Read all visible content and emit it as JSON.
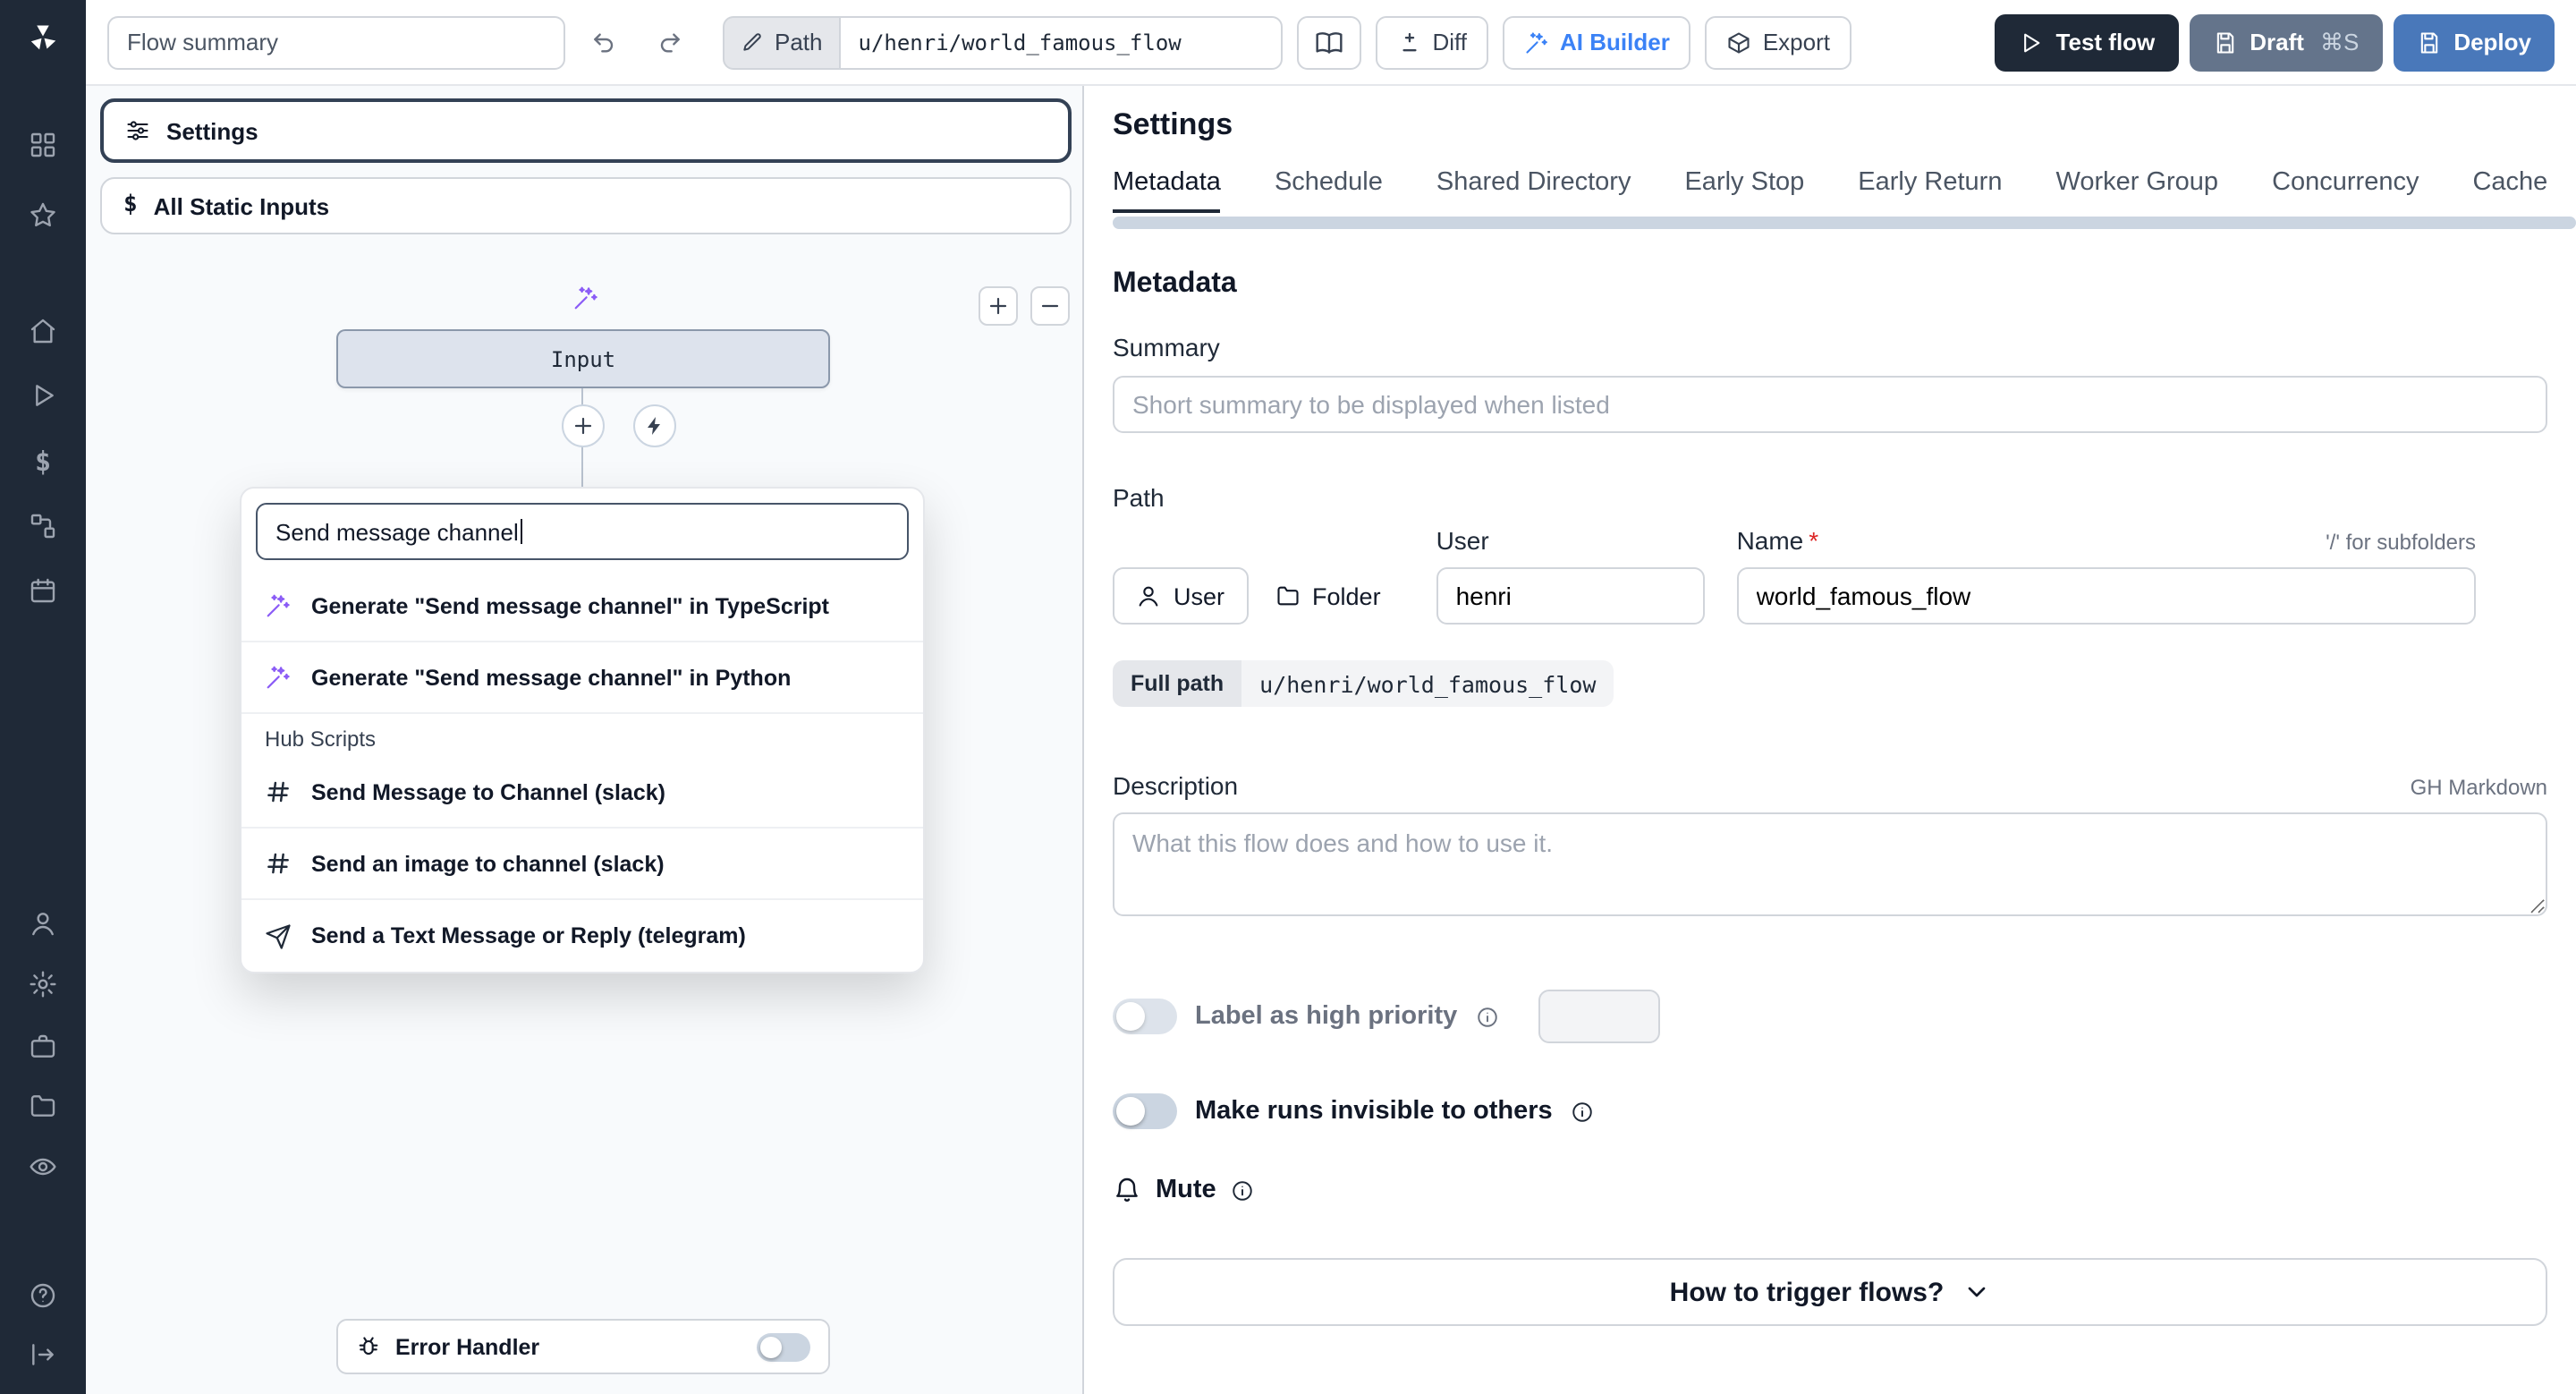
{
  "topbar": {
    "flow_summary_placeholder": "Flow summary",
    "path_chip": "Path",
    "path_value": "u/henri/world_famous_flow",
    "diff": "Diff",
    "ai_builder": "AI Builder",
    "export": "Export",
    "test_flow": "Test flow",
    "draft": "Draft",
    "draft_shortcut": "⌘S",
    "deploy": "Deploy"
  },
  "flow": {
    "settings_node": "Settings",
    "static_inputs_node": "All Static Inputs",
    "input_node": "Input",
    "error_handler": "Error Handler",
    "search_value": "Send message channel",
    "menu": {
      "generate_items": [
        "Generate \"Send message channel\" in TypeScript",
        "Generate \"Send message channel\" in Python"
      ],
      "section_header": "Hub Scripts",
      "hub_items": [
        "Send Message to Channel (slack)",
        "Send an image to channel (slack)",
        "Send a Text Message or Reply (telegram)"
      ]
    }
  },
  "settings": {
    "title": "Settings",
    "tabs": [
      "Metadata",
      "Schedule",
      "Shared Directory",
      "Early Stop",
      "Early Return",
      "Worker Group",
      "Concurrency",
      "Cache"
    ],
    "active_tab": "Metadata",
    "heading": "Metadata",
    "summary_label": "Summary",
    "summary_placeholder": "Short summary to be displayed when listed",
    "path_label": "Path",
    "owner_user": "User",
    "owner_folder": "Folder",
    "user_label": "User",
    "user_value": "henri",
    "name_label": "Name",
    "required_mark": "*",
    "subfolder_hint": "'/' for subfolders",
    "name_value": "world_famous_flow",
    "full_path_label": "Full path",
    "full_path_value": "u/henri/world_famous_flow",
    "description_label": "Description",
    "markdown_hint": "GH Markdown",
    "description_placeholder": "What this flow does and how to use it.",
    "priority_label": "Label as high priority",
    "invisible_label": "Make runs invisible to others",
    "mute_label": "Mute",
    "trigger_button": "How to trigger flows?"
  },
  "icons": {
    "wand-icon": "✨ magic wand (AI generate)",
    "slack-icon": "# slack hash",
    "telegram-icon": "➤ paper plane",
    "bug-icon": "error handler bug",
    "bell-icon": "mute bell",
    "info-icon": "ⓘ",
    "diff-icon": "±",
    "dollar-icon": "$"
  },
  "colors": {
    "sidebar": "#1f2937",
    "canvas": "#f8fafc",
    "test_flow_button": "#1f2937",
    "draft_button": "#64748b",
    "deploy_button": "#4978ba",
    "ai_accent": "#3b82f6",
    "wand_accent": "#8b5cf6",
    "required": "#dc2626"
  }
}
